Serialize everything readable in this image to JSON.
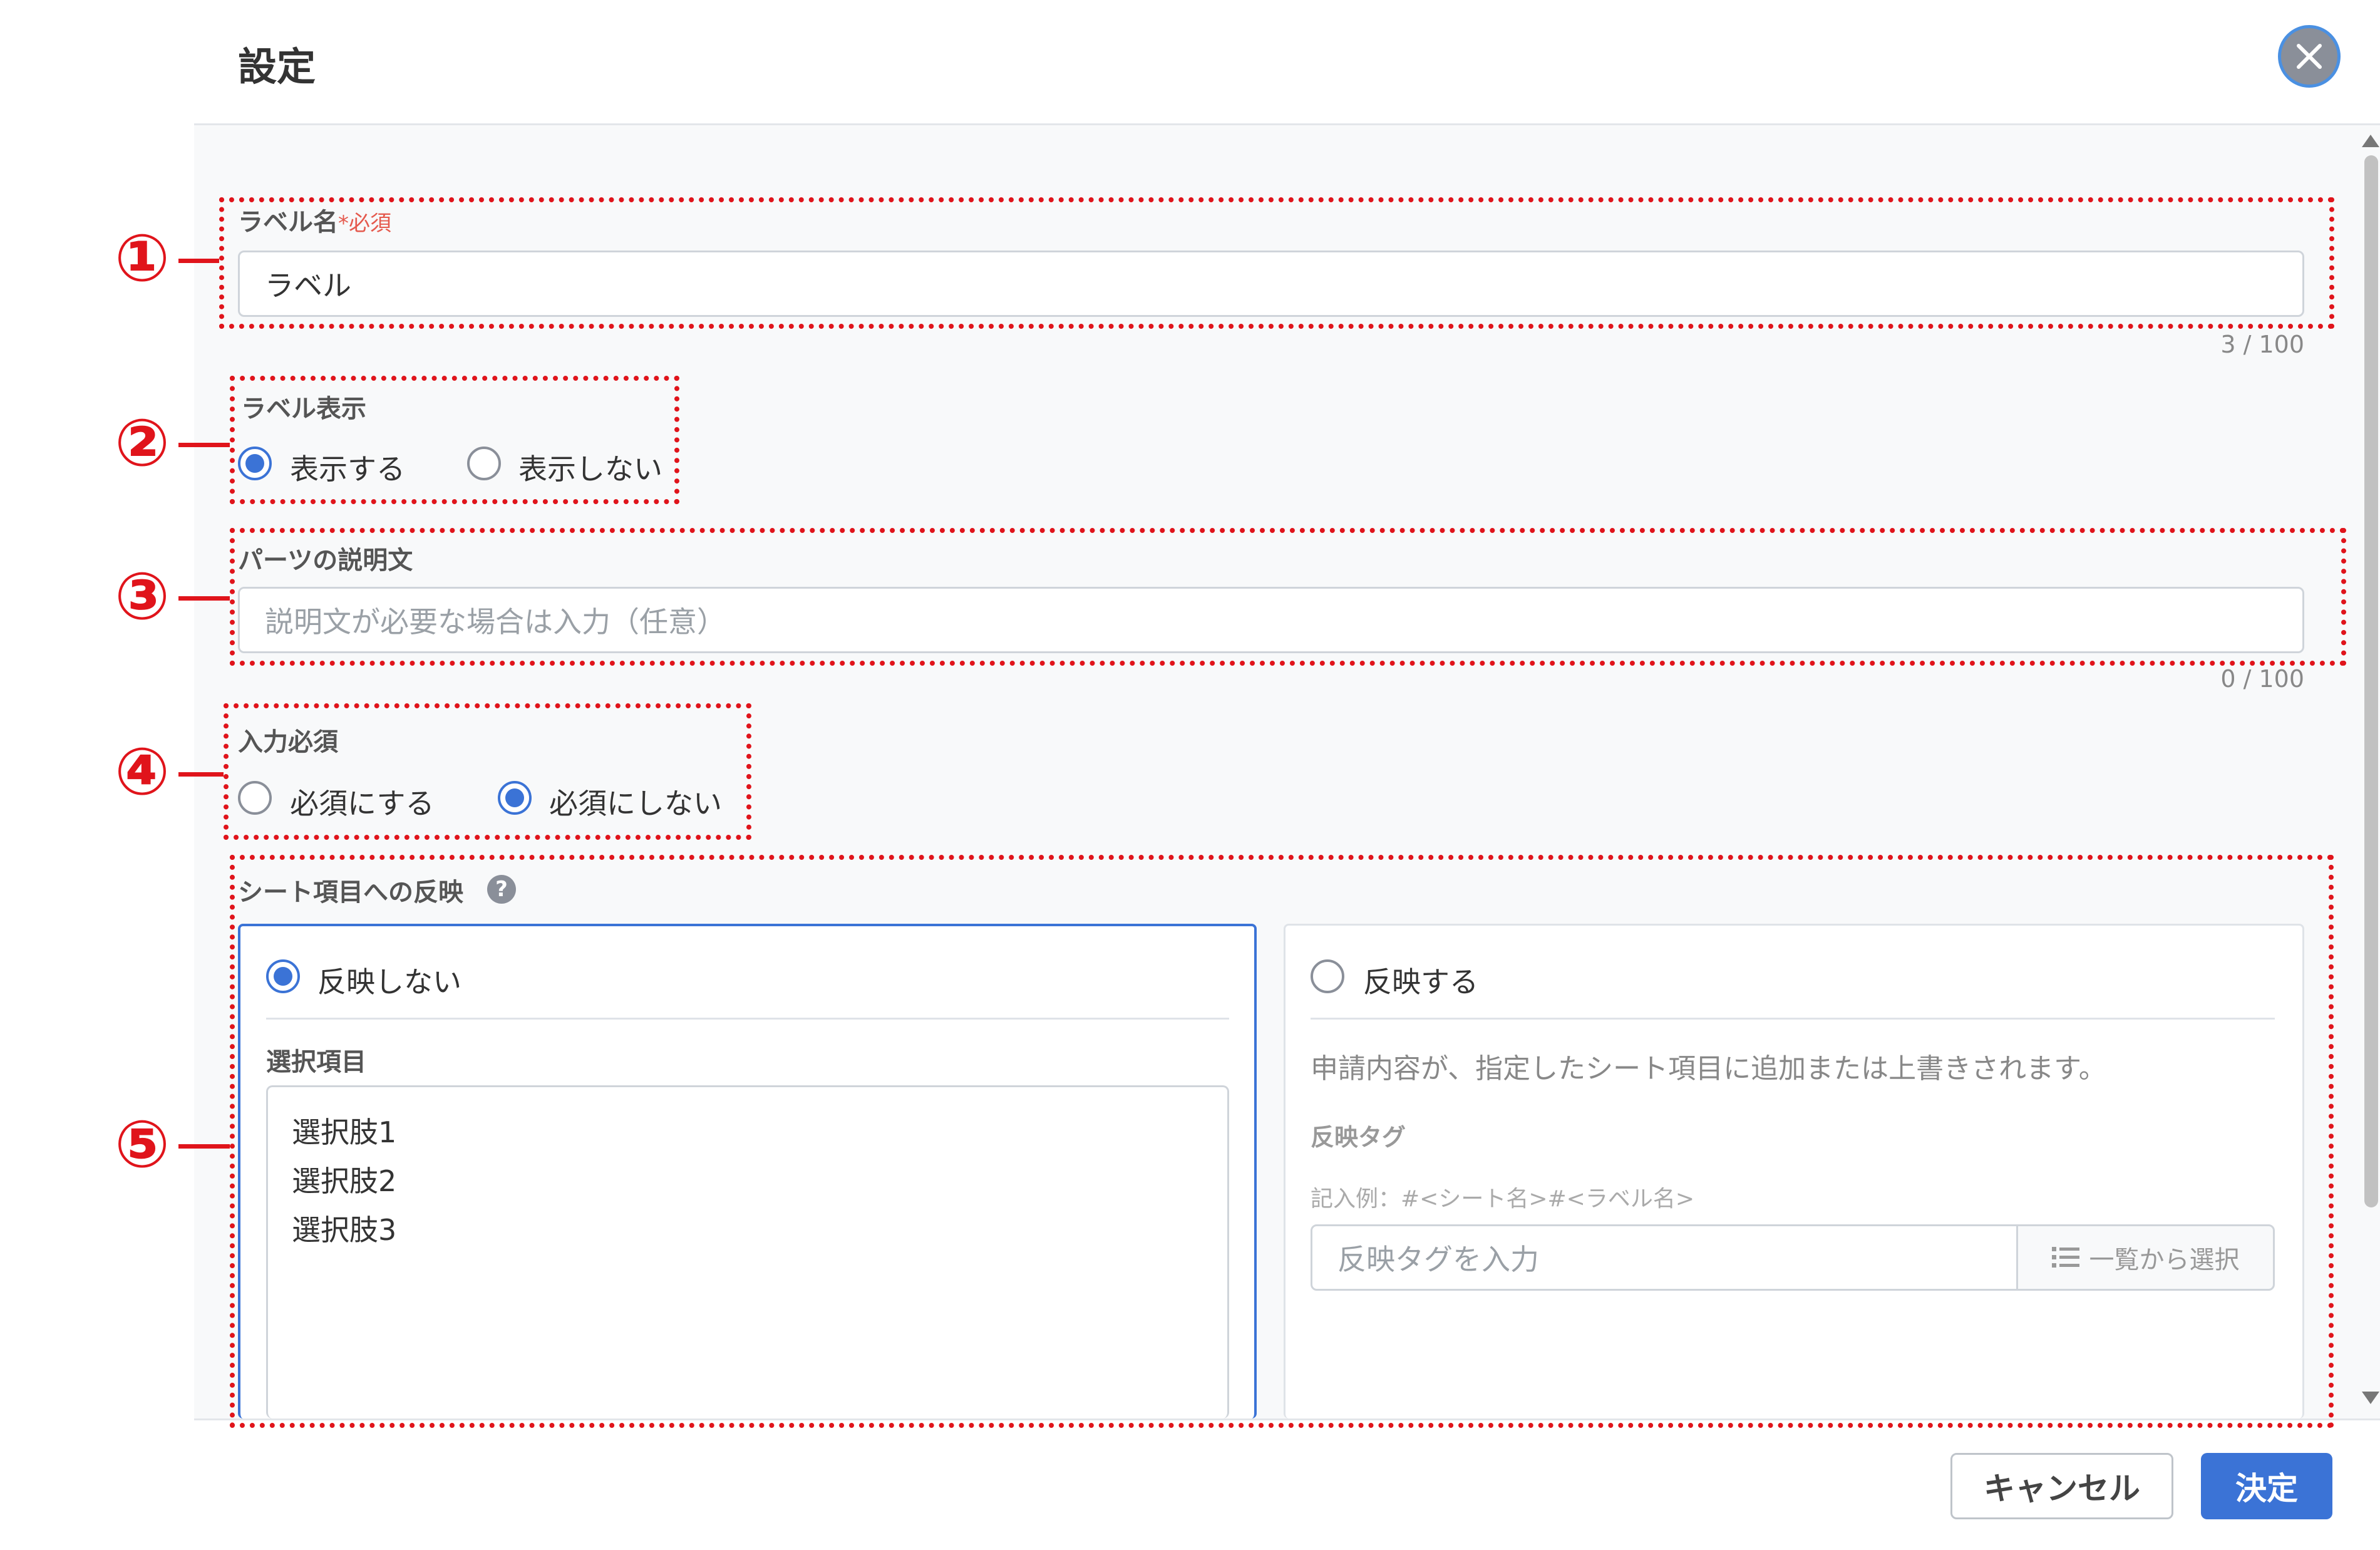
{
  "dialog": {
    "title": "設定",
    "close_icon": "close-icon"
  },
  "label_name": {
    "label": "ラベル名",
    "required_mark": "*必須",
    "value": "ラベル",
    "counter": "3 / 100"
  },
  "label_display": {
    "label": "ラベル表示",
    "options": [
      "表示する",
      "表示しない"
    ],
    "selected": "表示する"
  },
  "description": {
    "label": "パーツの説明文",
    "placeholder": "説明文が必要な場合は入力（任意）",
    "value": "",
    "counter": "0 / 100"
  },
  "input_required": {
    "label": "入力必須",
    "options": [
      "必須にする",
      "必須にしない"
    ],
    "selected": "必須にしない"
  },
  "sheet_reflection": {
    "label": "シート項目への反映",
    "help_icon": "question-circle-icon",
    "selected": "反映しない",
    "no_reflect": {
      "option_label": "反映しない",
      "items_label": "選択項目",
      "items": [
        "選択肢1",
        "選択肢2",
        "選択肢3"
      ]
    },
    "reflect": {
      "option_label": "反映する",
      "description": "申請内容が、指定したシート項目に追加または上書きされます。",
      "tag_label": "反映タグ",
      "example": "記入例：#<シート名>#<ラベル名>",
      "tag_placeholder": "反映タグを入力",
      "list_button": "一覧から選択",
      "list_icon": "list-icon"
    }
  },
  "footer": {
    "cancel": "キャンセル",
    "confirm": "決定"
  },
  "annotations": [
    "①",
    "②",
    "③",
    "④",
    "⑤"
  ],
  "colors": {
    "accent": "#3b73d6",
    "annotation": "#e0141b",
    "required": "#e55a4e"
  }
}
